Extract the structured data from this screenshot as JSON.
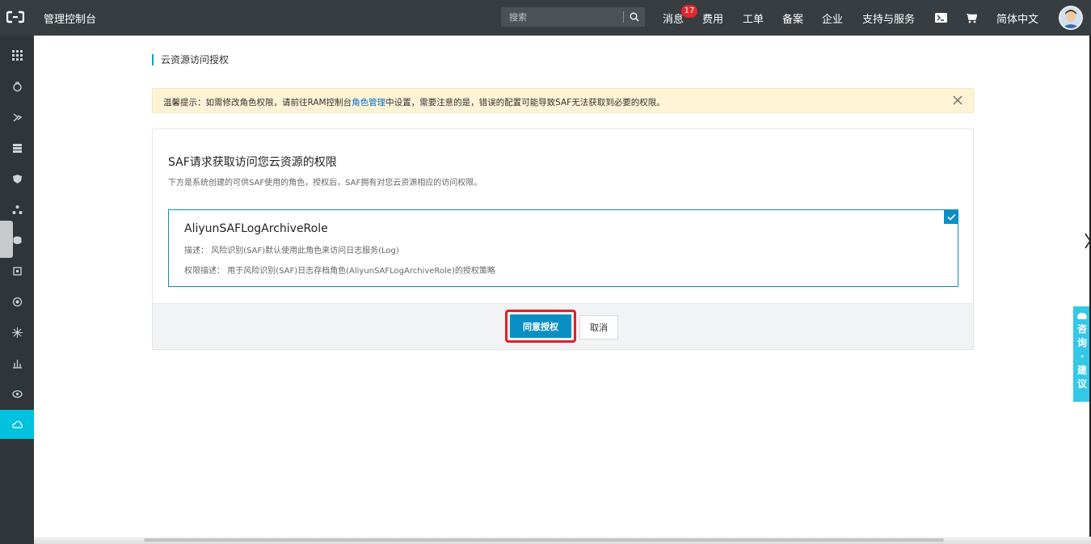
{
  "topbar": {
    "console_title": "管理控制台",
    "search_placeholder": "搜索",
    "nav": {
      "messages": "消息",
      "messages_count": "17",
      "fees": "费用",
      "tickets": "工单",
      "icp": "备案",
      "enterprise": "企业",
      "support": "支持与服务",
      "language": "简体中文"
    }
  },
  "sidebar": {
    "items": [
      "grid-icon",
      "product-icon-1",
      "product-icon-2",
      "product-icon-3",
      "product-icon-4",
      "product-icon-5",
      "product-icon-6",
      "product-icon-7",
      "product-icon-8",
      "product-icon-9",
      "product-icon-10",
      "product-icon-11",
      "cloud-icon"
    ],
    "active_index": 12
  },
  "breadcrumb": "云资源访问授权",
  "notice": {
    "prefix": "温馨提示：如需修改角色权限，请前往RAM控制台",
    "link": "角色管理",
    "suffix": "中设置，需要注意的是，错误的配置可能导致SAF无法获取到必要的权限。"
  },
  "panel": {
    "title": "SAF请求获取访问您云资源的权限",
    "subtitle": "下方是系统创建的可供SAF使用的角色，授权后，SAF拥有对您云资源相应的访问权限。",
    "role": {
      "name": "AliyunSAFLogArchiveRole",
      "description": "描述：  风险识别(SAF)默认使用此角色来访问日志服务(Log)",
      "permission": "权限描述：  用于风险识别(SAF)日志存档角色(AliyunSAFLogArchiveRole)的授权策略",
      "selected": true
    },
    "agree_label": "同意授权",
    "cancel_label": "取消"
  },
  "consult": {
    "chars": [
      "咨",
      "询",
      "·",
      "建",
      "议"
    ]
  },
  "colors": {
    "topbar": "#373d41",
    "sidebar": "#2f3539",
    "accent": "#0a8fc4",
    "active": "#00c1de",
    "highlight": "#e0202a"
  }
}
